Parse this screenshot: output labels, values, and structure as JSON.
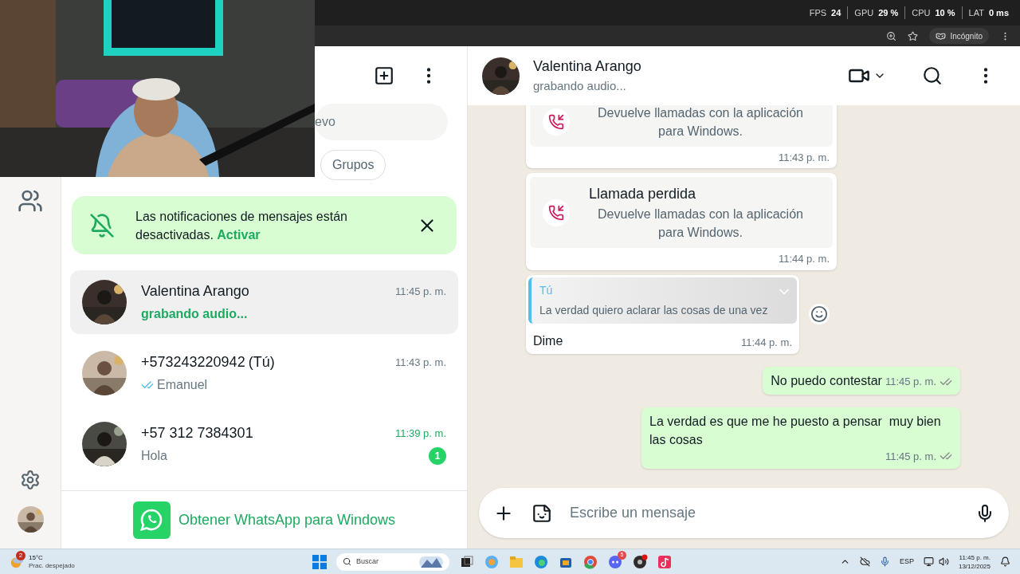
{
  "browser": {
    "stats": [
      {
        "label": "FPS",
        "value": "24"
      },
      {
        "label": "GPU",
        "value": "29 %"
      },
      {
        "label": "CPU",
        "value": "10 %"
      },
      {
        "label": "LAT",
        "value": "0 ms"
      }
    ],
    "incognito": "Incógnito"
  },
  "chat_list": {
    "search": {
      "placeholder": "evo"
    },
    "filters": [
      {
        "label": "Grupos",
        "selected": false
      }
    ],
    "banner": {
      "text": "Las notificaciones de mensajes están desactivadas.",
      "action": "Activar"
    },
    "chats": [
      {
        "name": "Valentina Arango",
        "time": "11:45 p. m.",
        "preview": "grabando audio...",
        "kind": "typing",
        "selected": true
      },
      {
        "name": "+573243220942",
        "suffix": "(Tú)",
        "time": "11:43 p. m.",
        "preview": "Emanuel",
        "kind": "read",
        "selected": false
      },
      {
        "name": "+57 312 7384301",
        "time": "11:39 p. m.",
        "preview": "Hola",
        "kind": "text",
        "unread": "1",
        "selected": false
      }
    ],
    "footer": "Obtener WhatsApp para Windows"
  },
  "chat": {
    "name": "Valentina Arango",
    "status": "grabando audio...",
    "messages": [
      {
        "kind": "call",
        "text": "Devuelve llamadas con la aplicación para Windows.",
        "time": "11:43 p. m."
      },
      {
        "kind": "call",
        "title": "Llamada perdida",
        "text": "Devuelve llamadas con la aplicación para Windows.",
        "time": "11:44 p. m."
      },
      {
        "kind": "reply",
        "author": "Tú",
        "quote": "La verdad quiero aclarar las cosas de una vez",
        "text": "Dime",
        "time": "11:44 p. m."
      },
      {
        "kind": "out",
        "text": "No puedo contestar",
        "time": "11:45 p. m.",
        "read": false
      },
      {
        "kind": "out",
        "text": "La verdad es que me he puesto a pensar  muy bien las cosas",
        "time": "11:45 p. m.",
        "read": false
      }
    ],
    "input": {
      "placeholder": "Escribe un mensaje"
    }
  },
  "taskbar": {
    "weather_badge": "2",
    "temperature": "15°C",
    "condition": "Prac. despejado",
    "search": "Buscar",
    "discord_badge": "5",
    "language": "ESP",
    "time": "11:45 p. m.",
    "date": "13/12/2025"
  }
}
